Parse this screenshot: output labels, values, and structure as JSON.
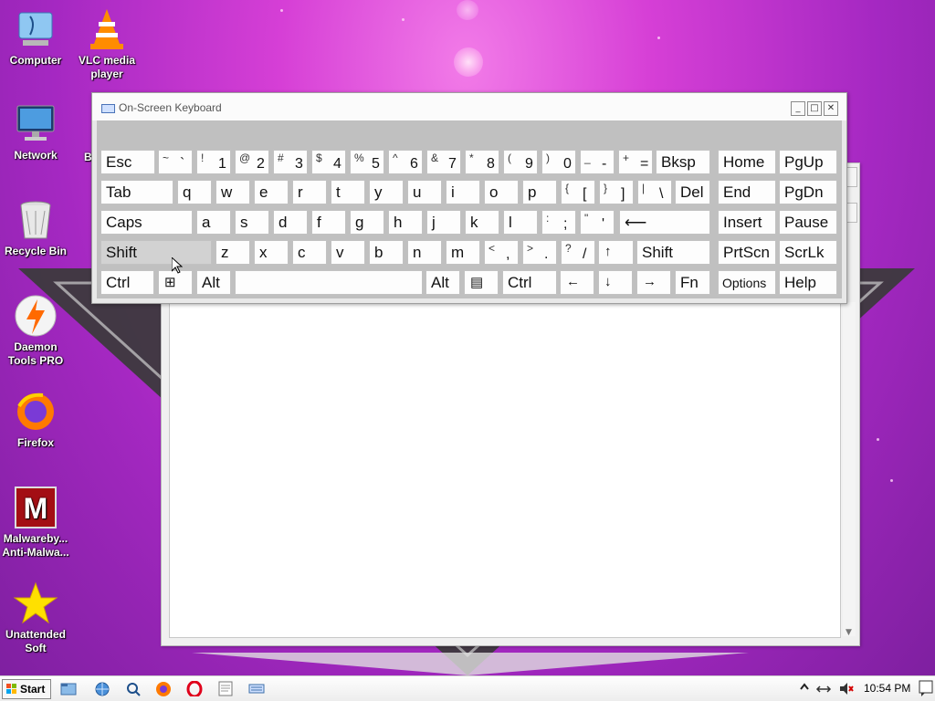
{
  "desktop": {
    "icons": [
      {
        "id": "computer",
        "label": "Computer"
      },
      {
        "id": "vlc",
        "label": "VLC media player"
      },
      {
        "id": "network",
        "label": "Network"
      },
      {
        "id": "recycle-bin",
        "label": "Recycle Bin"
      },
      {
        "id": "daemon-tools",
        "label": "Daemon Tools PRO"
      },
      {
        "id": "firefox",
        "label": "Firefox"
      },
      {
        "id": "malwarebytes",
        "label": "Malwareby... Anti-Malwa..."
      },
      {
        "id": "unattended",
        "label": "Unattended Soft"
      }
    ],
    "partial_label": "B"
  },
  "osk": {
    "title": "On-Screen Keyboard",
    "window_buttons": {
      "minimize": "_",
      "maximize": "□",
      "close": "✕"
    },
    "keys": {
      "esc": "Esc",
      "bksp": "Bksp",
      "home": "Home",
      "pgup": "PgUp",
      "tab": "Tab",
      "del": "Del",
      "end": "End",
      "pgdn": "PgDn",
      "caps": "Caps",
      "insert": "Insert",
      "pause": "Pause",
      "shift": "Shift",
      "prtscn": "PrtScn",
      "scrlk": "ScrLk",
      "ctrl": "Ctrl",
      "alt": "Alt",
      "fn": "Fn",
      "options": "Options",
      "help": "Help",
      "enter_arrow": "⟵",
      "left": "←",
      "right": "→",
      "up": "↑",
      "down": "↓",
      "win": "⊞",
      "menu": "▤",
      "row1": [
        {
          "hi": "~",
          "lo": "`"
        },
        {
          "hi": "!",
          "lo": "1"
        },
        {
          "hi": "@",
          "lo": "2"
        },
        {
          "hi": "#",
          "lo": "3"
        },
        {
          "hi": "$",
          "lo": "4"
        },
        {
          "hi": "%",
          "lo": "5"
        },
        {
          "hi": "^",
          "lo": "6"
        },
        {
          "hi": "&",
          "lo": "7"
        },
        {
          "hi": "*",
          "lo": "8"
        },
        {
          "hi": "(",
          "lo": "9"
        },
        {
          "hi": ")",
          "lo": "0"
        },
        {
          "hi": "_",
          "lo": "-"
        },
        {
          "hi": "+",
          "lo": "="
        }
      ],
      "row2": [
        "q",
        "w",
        "e",
        "r",
        "t",
        "y",
        "u",
        "i",
        "o",
        "p"
      ],
      "row2_sym": [
        {
          "hi": "{",
          "lo": "["
        },
        {
          "hi": "}",
          "lo": "]"
        },
        {
          "hi": "|",
          "lo": "\\"
        }
      ],
      "row3": [
        "a",
        "s",
        "d",
        "f",
        "g",
        "h",
        "j",
        "k",
        "l"
      ],
      "row3_sym": [
        {
          "hi": ":",
          "lo": ";"
        },
        {
          "hi": "\"",
          "lo": "'"
        }
      ],
      "row4": [
        "z",
        "x",
        "c",
        "v",
        "b",
        "n",
        "m"
      ],
      "row4_sym": [
        {
          "hi": "<",
          "lo": ","
        },
        {
          "hi": ">",
          "lo": "."
        },
        {
          "hi": "?",
          "lo": "/"
        }
      ]
    }
  },
  "taskbar": {
    "start_label": "Start",
    "clock": "10:54 PM"
  },
  "colors": {
    "desktop_magenta": "#d63fd6",
    "osk_key_background": "#fdfdfd",
    "osk_panel": "#c0c0c0"
  }
}
